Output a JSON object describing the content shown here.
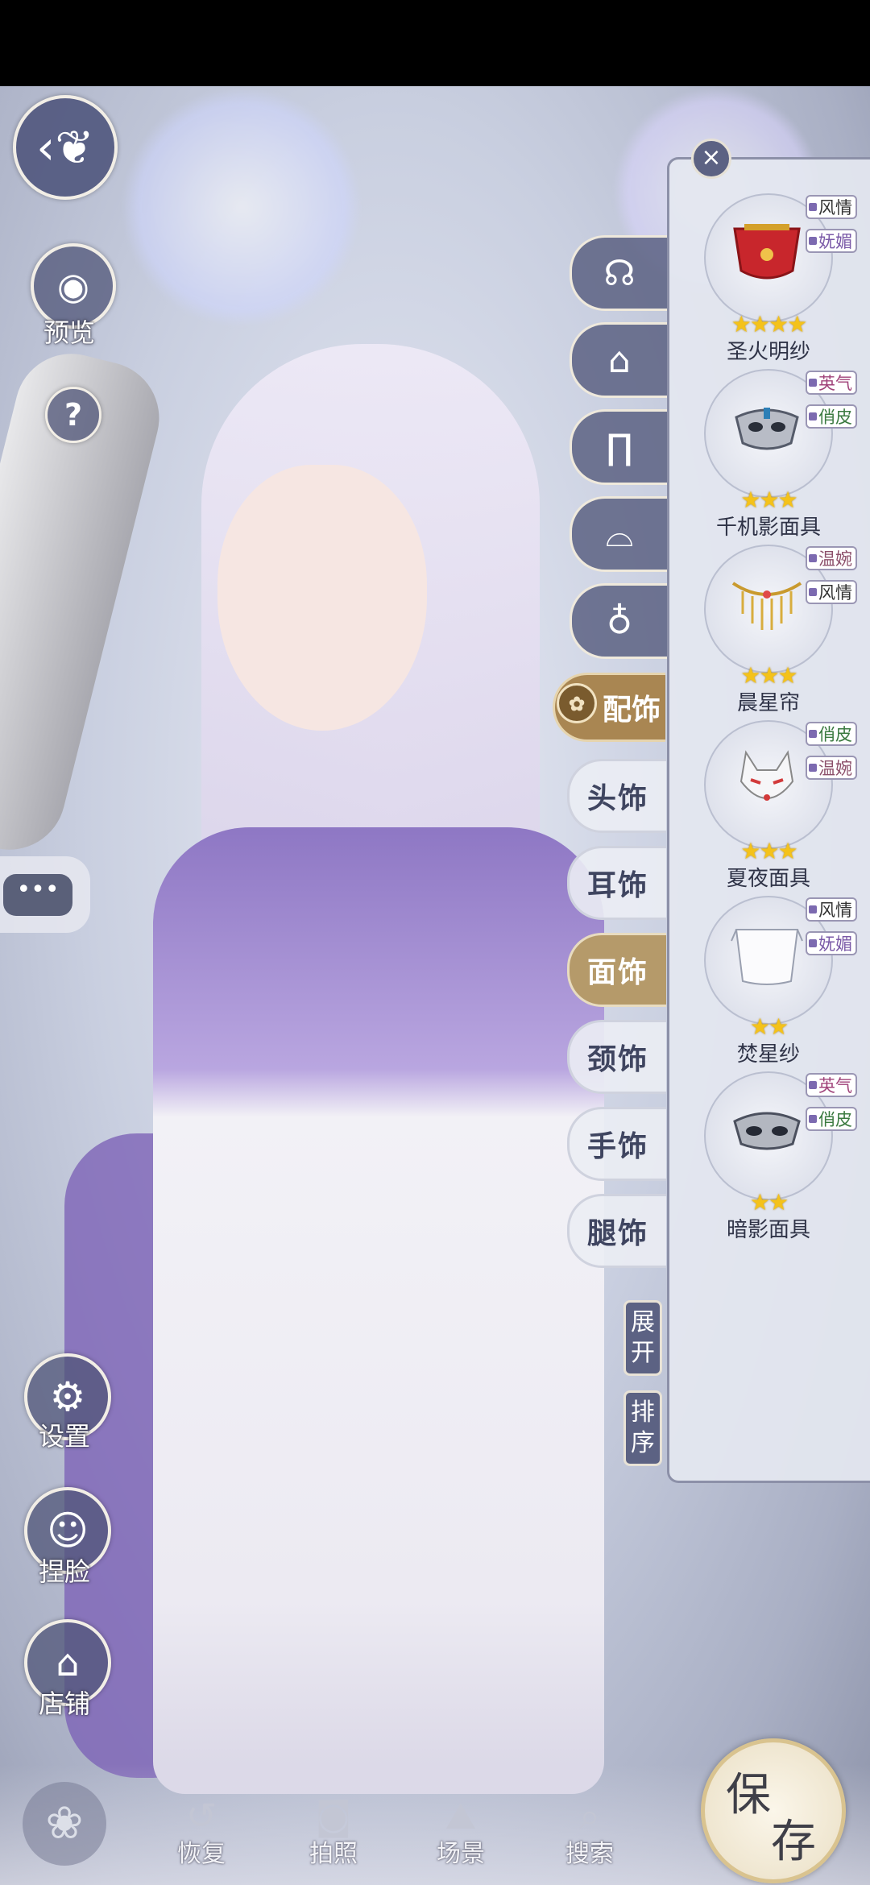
{
  "left_controls": {
    "preview_label": "预览",
    "help_symbol": "?",
    "settings_label": "设置",
    "face_label": "捏脸",
    "shop_label": "店铺",
    "chat_dots": "•••"
  },
  "categories": [
    "hair-icon",
    "top-icon",
    "pants-icon",
    "shoes-icon",
    "bells-icon"
  ],
  "accessory_tab": "配饰",
  "sub_tabs": [
    "头饰",
    "耳饰",
    "面饰",
    "颈饰",
    "手饰",
    "腿饰"
  ],
  "active_sub_tab": "面饰",
  "side_buttons": {
    "expand": "展开",
    "sort": "排序"
  },
  "items": [
    {
      "name": "圣火明纱",
      "stars": "★★★★",
      "star_count": 4,
      "tags": [
        "风情",
        "妩媚"
      ]
    },
    {
      "name": "千机影面具",
      "stars": "★★★",
      "star_count": 3,
      "tags": [
        "英气",
        "俏皮"
      ]
    },
    {
      "name": "晨星帘",
      "stars": "★★★",
      "star_count": 3,
      "tags": [
        "温婉",
        "风情"
      ]
    },
    {
      "name": "夏夜面具",
      "stars": "★★★",
      "star_count": 3,
      "tags": [
        "俏皮",
        "温婉"
      ]
    },
    {
      "name": "焚星纱",
      "stars": "★★",
      "star_count": 2,
      "tags": [
        "风情",
        "妩媚"
      ]
    },
    {
      "name": "暗影面具",
      "stars": "★★",
      "star_count": 2,
      "tags": [
        "英气",
        "俏皮"
      ]
    }
  ],
  "bottom_bar": {
    "restore": "恢复",
    "photo": "拍照",
    "scene": "场景",
    "search": "搜索",
    "save_char1": "保",
    "save_char2": "存"
  },
  "close_symbol": "×"
}
